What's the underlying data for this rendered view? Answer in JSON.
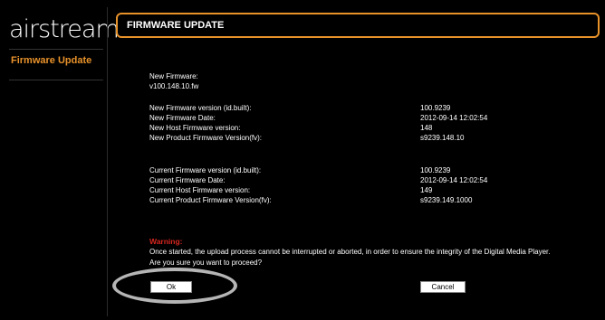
{
  "sidebar": {
    "logo": "airstream",
    "items": [
      {
        "label": "Firmware Update"
      }
    ]
  },
  "header": {
    "title": "FIRMWARE UPDATE"
  },
  "new_firmware": {
    "heading": "New Firmware:",
    "file": "v100.148.10.fw",
    "rows": [
      {
        "label": "New Firmware version (id.built):",
        "value": "100.9239"
      },
      {
        "label": "New Firmware Date:",
        "value": "2012-09-14  12:02:54"
      },
      {
        "label": "New Host Firmware version:",
        "value": "148"
      },
      {
        "label": "New Product Firmware Version(fv):",
        "value": "s9239.148.10"
      }
    ]
  },
  "current_firmware": {
    "rows": [
      {
        "label": "Current Firmware version (id.built):",
        "value": "100.9239"
      },
      {
        "label": "Current Firmware Date:",
        "value": "2012-09-14  12:02:54"
      },
      {
        "label": "Current Host Firmware version:",
        "value": "149"
      },
      {
        "label": "Current Product Firmware Version(fv):",
        "value": "s9239.149.1000"
      }
    ]
  },
  "warning": {
    "title": "Warning:",
    "message": "Once started, the upload process cannot be interrupted or aborted, in order to ensure the integrity of the Digital Media Player.",
    "question": "Are you sure you want to proceed?"
  },
  "buttons": {
    "ok": "Ok",
    "cancel": "Cancel"
  },
  "colors": {
    "accent": "#e8922a",
    "warning": "#d8261f",
    "background": "#000000"
  }
}
